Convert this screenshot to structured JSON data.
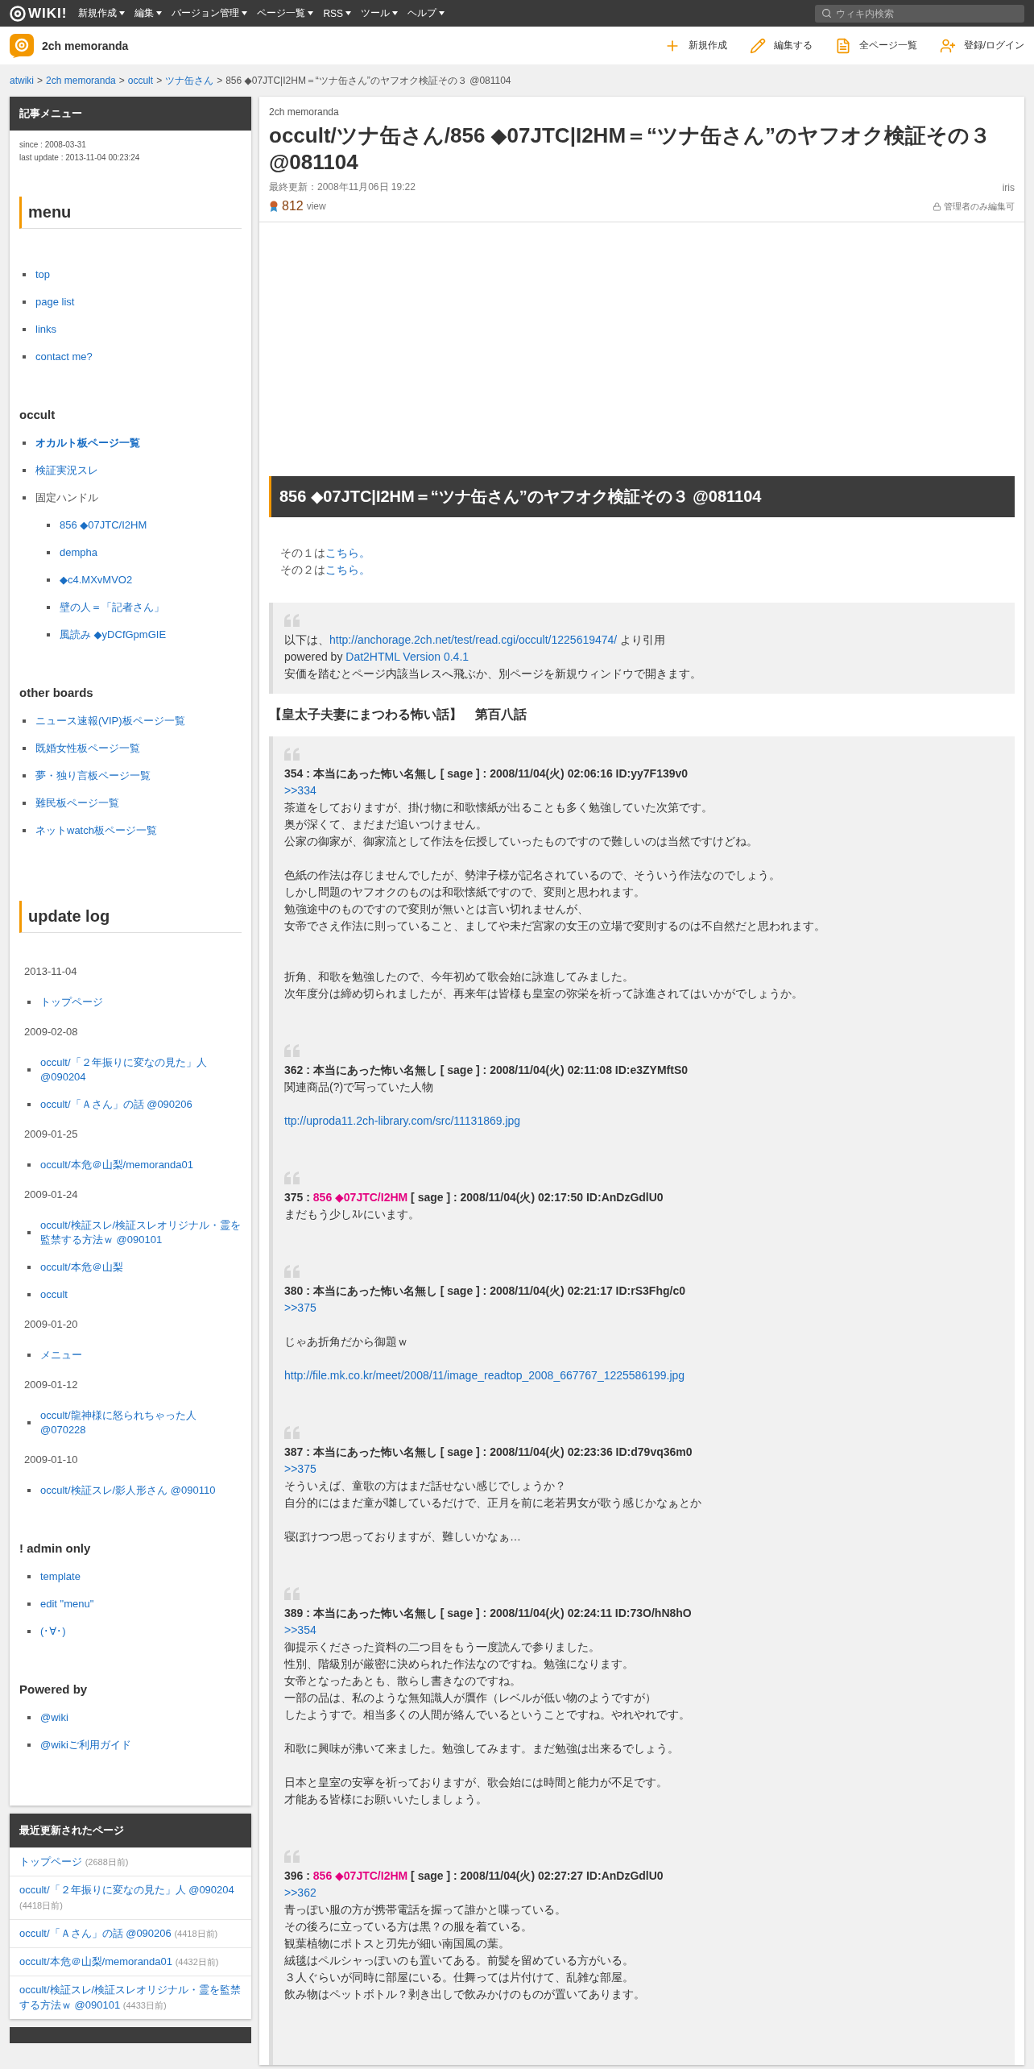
{
  "topbar": {
    "logo": "WIKI!",
    "menus": [
      "新規作成",
      "編集",
      "バージョン管理",
      "ページ一覧",
      "RSS",
      "ツール",
      "ヘルプ"
    ],
    "search": {
      "placeholder": "ウィキ内検索"
    }
  },
  "site_header": {
    "name": "2ch memoranda",
    "actions": [
      {
        "kind": "plus",
        "label": "新規作成"
      },
      {
        "kind": "edit",
        "label": "編集する"
      },
      {
        "kind": "list",
        "label": "全ページ一覧"
      },
      {
        "kind": "user",
        "label": "登録/ログイン"
      }
    ]
  },
  "breadcrumb": {
    "separator": ">",
    "links": [
      "atwiki",
      "2ch memoranda",
      "occult",
      "ツナ缶さん"
    ],
    "current": "856 ◆07JTC|I2HM＝“ツナ缶さん”のヤフオク検証その３ @081104"
  },
  "sidebar": {
    "title": "記事メニュー",
    "since": "since : 2008-03-31",
    "last_update": "last update : 2013-11-04 00:23:24",
    "sections": [
      {
        "kind": "heading",
        "title": "menu"
      },
      {
        "kind": "list",
        "items": [
          {
            "label": "top"
          },
          {
            "label": "page list"
          },
          {
            "label": "links"
          },
          {
            "label": "contact me?"
          }
        ]
      },
      {
        "kind": "subheading",
        "title": "occult"
      },
      {
        "kind": "list",
        "items": [
          {
            "label": "オカルト板ページ一覧",
            "bold": true
          },
          {
            "label": "検証実況スレ"
          },
          {
            "label": "固定ハンドル",
            "plain": true,
            "children": [
              {
                "label": "856 ◆07JTC/I2HM"
              },
              {
                "label": "dempha"
              },
              {
                "label": "◆c4.MXvMVO2"
              },
              {
                "label": "壁の人＝「記者さん」"
              },
              {
                "label": "風読み ◆yDCfGpmGIE"
              }
            ]
          }
        ]
      },
      {
        "kind": "subheading",
        "title": "other boards"
      },
      {
        "kind": "list",
        "items": [
          {
            "label": "ニュース速報(VIP)板ページ一覧"
          },
          {
            "label": "既婚女性板ページ一覧"
          },
          {
            "label": "夢・独り言板ページ一覧"
          },
          {
            "label": "難民板ページ一覧"
          },
          {
            "label": "ネットwatch板ページ一覧"
          }
        ]
      },
      {
        "kind": "heading",
        "title": "update log"
      },
      {
        "kind": "date",
        "title": "2013-11-04"
      },
      {
        "kind": "compact",
        "items": [
          {
            "label": "トップページ"
          }
        ]
      },
      {
        "kind": "date",
        "title": "2009-02-08"
      },
      {
        "kind": "compact",
        "items": [
          {
            "label": "occult/「２年振りに変なの見た」人 @090204"
          },
          {
            "label": "occult/「Ａさん」の話 @090206"
          }
        ]
      },
      {
        "kind": "date",
        "title": "2009-01-25"
      },
      {
        "kind": "compact",
        "items": [
          {
            "label": "occult/本危＠山梨/memoranda01"
          }
        ]
      },
      {
        "kind": "date",
        "title": "2009-01-24"
      },
      {
        "kind": "compact",
        "items": [
          {
            "label": "occult/検証スレ/検証スレオリジナル・霊を監禁する方法ｗ @090101"
          },
          {
            "label": "occult/本危＠山梨"
          },
          {
            "label": "occult"
          }
        ]
      },
      {
        "kind": "date",
        "title": "2009-01-20"
      },
      {
        "kind": "compact",
        "items": [
          {
            "label": "メニュー"
          }
        ]
      },
      {
        "kind": "date",
        "title": "2009-01-12"
      },
      {
        "kind": "compact",
        "items": [
          {
            "label": "occult/龍神様に怒られちゃった人 @070228"
          }
        ]
      },
      {
        "kind": "date",
        "title": "2009-01-10"
      },
      {
        "kind": "compact",
        "items": [
          {
            "label": "occult/検証スレ/影人形さん @090110"
          }
        ]
      },
      {
        "kind": "subheading",
        "title": "! admin only"
      },
      {
        "kind": "compact",
        "items": [
          {
            "label": "template"
          },
          {
            "label": "edit \"menu\""
          },
          {
            "label": "(･∀･)"
          }
        ]
      },
      {
        "kind": "subheading",
        "title": "Powered by"
      },
      {
        "kind": "compact",
        "items": [
          {
            "label": "@wiki"
          },
          {
            "label": "@wikiご利用ガイド"
          }
        ]
      }
    ]
  },
  "recent": {
    "title": "最近更新されたページ",
    "items": [
      {
        "title": "トップページ",
        "age": "(2688日前)"
      },
      {
        "title": "occult/「２年振りに変なの見た」人 @090204",
        "age": "(4418日前)"
      },
      {
        "title": "occult/「Ａさん」の話 @090206",
        "age": "(4418日前)"
      },
      {
        "title": "occult/本危＠山梨/memoranda01",
        "age": "(4432日前)"
      },
      {
        "title": "occult/検証スレ/検証スレオリジナル・霊を監禁する方法ｗ @090101",
        "age": "(4433日前)"
      }
    ]
  },
  "article": {
    "wiki": "2ch memoranda",
    "title": "occult/ツナ缶さん/856 ◆07JTC|I2HM＝“ツナ缶さん”のヤフオク検証その３ @081104",
    "updated": "最終更新：2008年11月06日 19:22",
    "author": "iris",
    "views": "812",
    "views_unit": "view",
    "permission": "管理者のみ編集可",
    "heading": "856 ◆07JTC|I2HM＝“ツナ缶さん”のヤフオク検証その３ @081104",
    "parts": [
      [
        {
          "kind": "text",
          "text": "その１は"
        },
        {
          "kind": "link",
          "text": "こちら。"
        }
      ],
      [
        {
          "kind": "text",
          "text": "その２は"
        },
        {
          "kind": "link",
          "text": "こちら。"
        }
      ]
    ],
    "intro": [
      [
        {
          "kind": "text",
          "text": "以下は、"
        },
        {
          "kind": "link",
          "text": "http://anchorage.2ch.net/test/read.cgi/occult/1225619474/"
        },
        {
          "kind": "text",
          "text": " より引用"
        }
      ],
      [
        {
          "kind": "text",
          "text": "powered by "
        },
        {
          "kind": "link",
          "text": "Dat2HTML Version 0.4.1"
        }
      ],
      [
        {
          "kind": "text",
          "text": "安価を踏むとページ内該当レスへ飛ぶか、別ページを新規ウィンドウで開きます。"
        }
      ]
    ],
    "thread_title": "【皇太子夫妻にまつわる怖い話】　第百八話",
    "posts": [
      {
        "number": "354 :",
        "name": "本当にあった怖い名無し",
        "trip": false,
        "meta": "[ sage ] : 2008/11/04(火) 02:06:16 ID:yy7F139v0",
        "lines": [
          {
            "kind": "link",
            "text": ">>334"
          },
          {
            "kind": "text",
            "text": "茶道をしておりますが、掛け物に和歌懐紙が出ることも多く勉強していた次第です。"
          },
          {
            "kind": "text",
            "text": "奥が深くて、まだまだ追いつけません。"
          },
          {
            "kind": "text",
            "text": "公家の御家が、御家流として作法を伝授していったものですので難しいのは当然ですけどね。"
          },
          {
            "kind": "blank"
          },
          {
            "kind": "text",
            "text": "色紙の作法は存じませんでしたが、勢津子様が記名されているので、そういう作法なのでしょう。"
          },
          {
            "kind": "text",
            "text": "しかし問題のヤフオクのものは和歌懐紙ですので、変則と思われます。"
          },
          {
            "kind": "text",
            "text": "勉強途中のものですので変則が無いとは言い切れませんが、"
          },
          {
            "kind": "text",
            "text": "女帝でさえ作法に則っていること、ましてや未だ宮家の女王の立場で変則するのは不自然だと思われます。"
          },
          {
            "kind": "blank"
          },
          {
            "kind": "blank"
          },
          {
            "kind": "text",
            "text": "折角、和歌を勉強したので、今年初めて歌会始に詠進してみました。"
          },
          {
            "kind": "text",
            "text": "次年度分は締め切られましたが、再来年は皆様も皇室の弥栄を祈って詠進されてはいかがでしょうか。"
          }
        ]
      },
      {
        "number": "362 :",
        "name": "本当にあった怖い名無し",
        "trip": false,
        "meta": "[ sage ] : 2008/11/04(火) 02:11:08 ID:e3ZYMftS0",
        "lines": [
          {
            "kind": "text",
            "text": "関連商品(?)で写っていた人物"
          },
          {
            "kind": "blank"
          },
          {
            "kind": "link",
            "text": "ttp://uproda11.2ch-library.com/src/11131869.jpg"
          }
        ]
      },
      {
        "number": "375 :",
        "name": "856 ◆07JTC/I2HM",
        "trip": true,
        "meta": "[ sage ] : 2008/11/04(火) 02:17:50 ID:AnDzGdlU0",
        "lines": [
          {
            "kind": "text",
            "text": "まだもう少しｽﾚにいます。"
          }
        ]
      },
      {
        "number": "380 :",
        "name": "本当にあった怖い名無し",
        "trip": false,
        "meta": "[ sage ] : 2008/11/04(火) 02:21:17 ID:rS3Fhg/c0",
        "lines": [
          {
            "kind": "link",
            "text": ">>375"
          },
          {
            "kind": "blank"
          },
          {
            "kind": "text",
            "text": "じゃあ折角だから御題ｗ"
          },
          {
            "kind": "blank"
          },
          {
            "kind": "link",
            "text": "http://file.mk.co.kr/meet/2008/11/image_readtop_2008_667767_1225586199.jpg"
          }
        ]
      },
      {
        "number": "387 :",
        "name": "本当にあった怖い名無し",
        "trip": false,
        "meta": "[ sage ] : 2008/11/04(火) 02:23:36 ID:d79vq36m0",
        "lines": [
          {
            "kind": "link",
            "text": ">>375"
          },
          {
            "kind": "text",
            "text": "そういえば、童歌の方はまだ話せない感じでしょうか？"
          },
          {
            "kind": "text",
            "text": "自分的にはまだ童が囃しているだけで、正月を前に老若男女が歌う感じかなぁとか"
          },
          {
            "kind": "blank"
          },
          {
            "kind": "text",
            "text": "寝ぼけつつ思っておりますが、難しいかなぁ…"
          }
        ]
      },
      {
        "number": "389 :",
        "name": "本当にあった怖い名無し",
        "trip": false,
        "meta": "[ sage ] : 2008/11/04(火) 02:24:11 ID:73O/hN8hO",
        "lines": [
          {
            "kind": "link",
            "text": ">>354"
          },
          {
            "kind": "text",
            "text": "御提示くださった資料の二つ目をもう一度読んで参りました。"
          },
          {
            "kind": "text",
            "text": "性別、階級別が厳密に決められた作法なのですね。勉強になります。"
          },
          {
            "kind": "text",
            "text": "女帝となったあとも、散らし書きなのですね。"
          },
          {
            "kind": "text",
            "text": "一部の品は、私のような無知識人が贋作（レベルが低い物のようですが）"
          },
          {
            "kind": "text",
            "text": "したようすで。相当多くの人間が絡んでいるということですね。やれやれです。"
          },
          {
            "kind": "blank"
          },
          {
            "kind": "text",
            "text": "和歌に興味が沸いて来ました。勉強してみます。まだ勉強は出来るでしょう。"
          },
          {
            "kind": "blank"
          },
          {
            "kind": "text",
            "text": "日本と皇室の安寧を祈っておりますが、歌会始には時間と能力が不足です。"
          },
          {
            "kind": "text",
            "text": "才能ある皆様にお願いいたしましょう。"
          }
        ]
      },
      {
        "number": "396 :",
        "name": "856 ◆07JTC/I2HM",
        "trip": true,
        "meta": "[ sage ] : 2008/11/04(火) 02:27:27 ID:AnDzGdlU0",
        "lines": [
          {
            "kind": "link",
            "text": ">>362"
          },
          {
            "kind": "text",
            "text": "青っぽい服の方が携帯電話を握って誰かと喋っている。"
          },
          {
            "kind": "text",
            "text": "その後ろに立っている方は黒？の服を着ている。"
          },
          {
            "kind": "text",
            "text": "観葉植物にポトスと刃先が細い南国風の葉。"
          },
          {
            "kind": "text",
            "text": "絨毯はペルシャっぽいのも置いてある。前髪を留めている方がいる。"
          },
          {
            "kind": "text",
            "text": "３人ぐらいが同時に部屋にいる。仕舞っては片付けて、乱雑な部屋。"
          },
          {
            "kind": "text",
            "text": "飲み物はペットボトル？剥き出しで飲みかけのものが置いてあります。"
          }
        ]
      }
    ]
  }
}
